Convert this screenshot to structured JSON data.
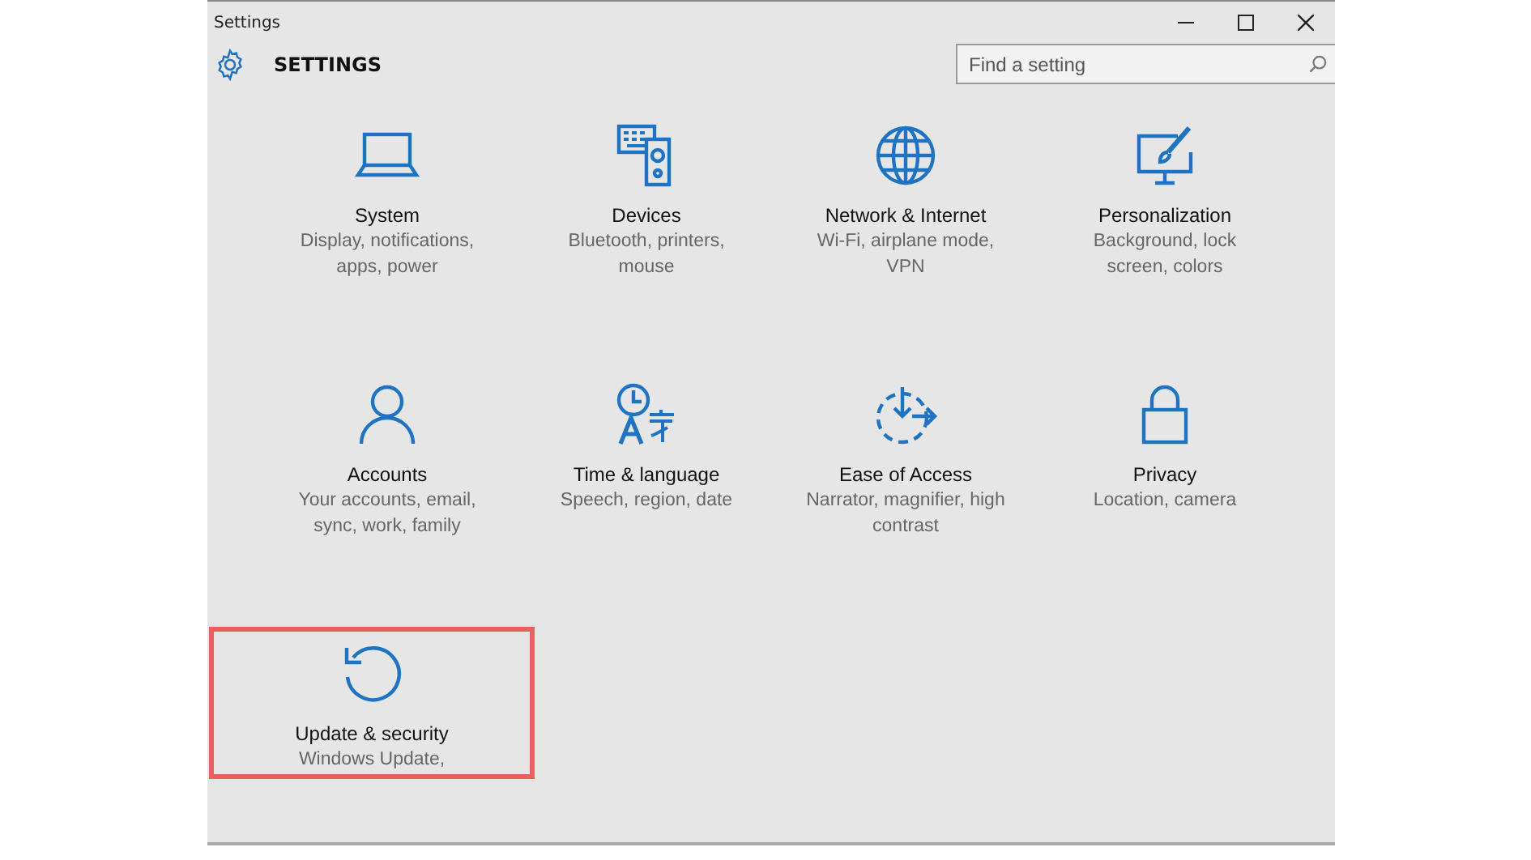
{
  "window": {
    "title": "Settings"
  },
  "header": {
    "title": "SETTINGS"
  },
  "search": {
    "placeholder": "Find a setting"
  },
  "tiles": [
    {
      "name": "System",
      "description": "Display, notifications, apps, power",
      "highlighted": false
    },
    {
      "name": "Devices",
      "description": "Bluetooth, printers, mouse",
      "highlighted": false
    },
    {
      "name": "Network & Internet",
      "description": "Wi-Fi, airplane mode, VPN",
      "highlighted": false
    },
    {
      "name": "Personalization",
      "description": "Background, lock screen, colors",
      "highlighted": false
    },
    {
      "name": "Accounts",
      "description": "Your accounts, email, sync, work, family",
      "highlighted": false
    },
    {
      "name": "Time & language",
      "description": "Speech, region, date",
      "highlighted": false
    },
    {
      "name": "Ease of Access",
      "description": "Narrator, magnifier, high contrast",
      "highlighted": false
    },
    {
      "name": "Privacy",
      "description": "Location, camera",
      "highlighted": false
    },
    {
      "name": "Update & security",
      "description": "Windows Update,",
      "highlighted": true
    }
  ]
}
